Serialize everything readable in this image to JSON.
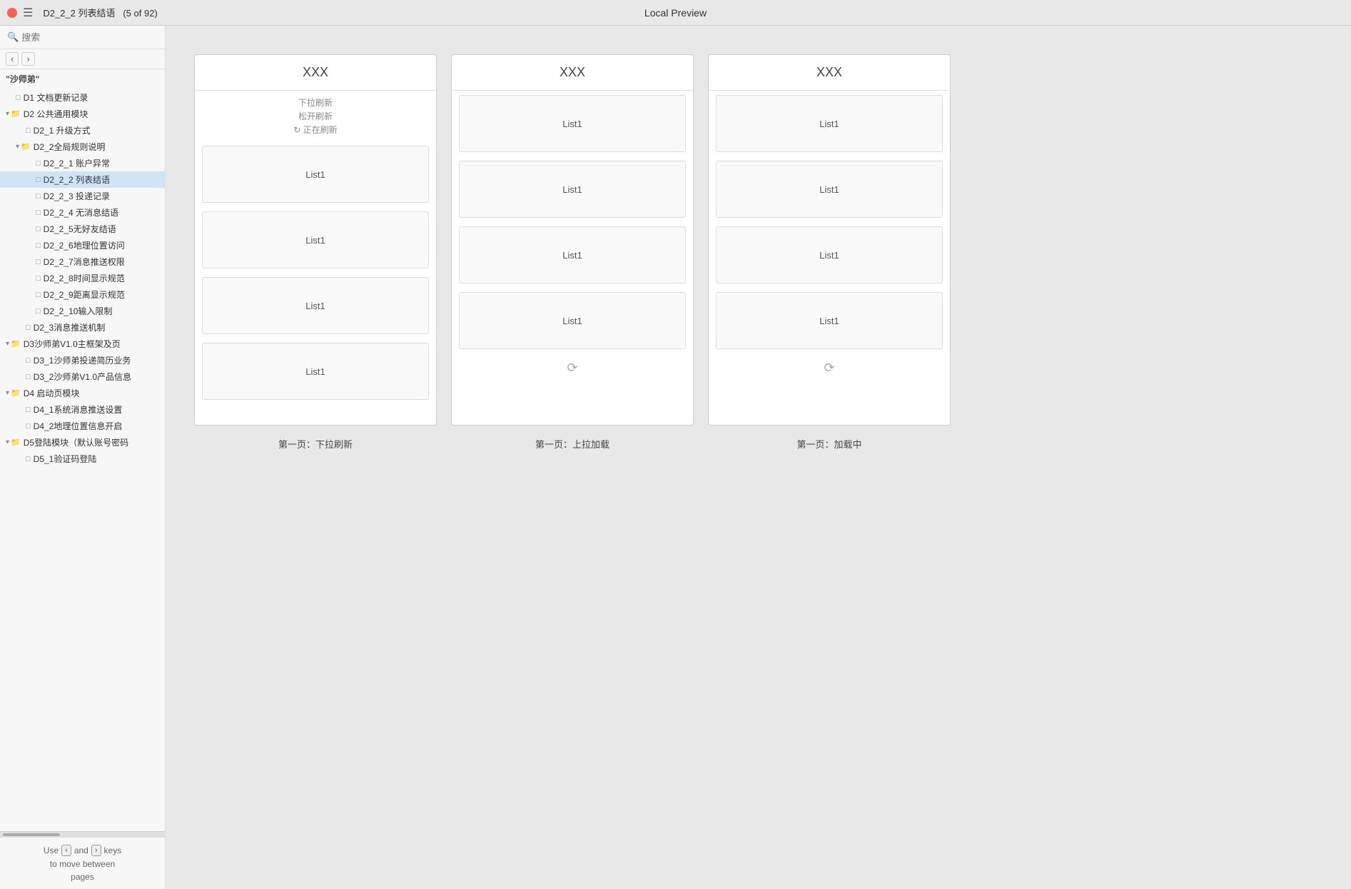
{
  "topbar": {
    "title": "D2_2_2 列表结语",
    "subtitle": "(5 of 92)",
    "preview_title": "Local Preview",
    "close_btn": "×"
  },
  "sidebar": {
    "search_placeholder": "搜索",
    "nav_back": "‹",
    "nav_forward": "›",
    "root_label": "\"沙师弟\"",
    "tree_items": [
      {
        "id": "d1",
        "label": "D1 文档更新记录",
        "level": 0,
        "type": "doc",
        "expanded": false
      },
      {
        "id": "d2",
        "label": "D2 公共通用模块",
        "level": 0,
        "type": "folder-open",
        "expanded": true
      },
      {
        "id": "d2_1",
        "label": "D2_1 升级方式",
        "level": 1,
        "type": "doc",
        "expanded": false
      },
      {
        "id": "d2_2",
        "label": "D2_2全局规则说明",
        "level": 1,
        "type": "folder-open",
        "expanded": true
      },
      {
        "id": "d2_2_1",
        "label": "D2_2_1 账户异常",
        "level": 2,
        "type": "doc",
        "expanded": false
      },
      {
        "id": "d2_2_2",
        "label": "D2_2_2 列表结语",
        "level": 2,
        "type": "doc",
        "expanded": false,
        "active": true
      },
      {
        "id": "d2_2_3",
        "label": "D2_2_3 投递记录",
        "level": 2,
        "type": "doc",
        "expanded": false
      },
      {
        "id": "d2_2_4",
        "label": "D2_2_4 无消息结语",
        "level": 2,
        "type": "doc",
        "expanded": false
      },
      {
        "id": "d2_2_5",
        "label": "D2_2_5无好友结语",
        "level": 2,
        "type": "doc",
        "expanded": false
      },
      {
        "id": "d2_2_6",
        "label": "D2_2_6地理位置访问",
        "level": 2,
        "type": "doc",
        "expanded": false
      },
      {
        "id": "d2_2_7",
        "label": "D2_2_7消息推送权限",
        "level": 2,
        "type": "doc",
        "expanded": false
      },
      {
        "id": "d2_2_8",
        "label": "D2_2_8时间显示规范",
        "level": 2,
        "type": "doc",
        "expanded": false
      },
      {
        "id": "d2_2_9",
        "label": "D2_2_9距离显示规范",
        "level": 2,
        "type": "doc",
        "expanded": false
      },
      {
        "id": "d2_2_10",
        "label": "D2_2_10输入限制",
        "level": 2,
        "type": "doc",
        "expanded": false
      },
      {
        "id": "d2_3",
        "label": "D2_3消息推送机制",
        "level": 1,
        "type": "doc",
        "expanded": false
      },
      {
        "id": "d3",
        "label": "D3沙师弟V1.0主框架及页",
        "level": 0,
        "type": "folder",
        "expanded": true
      },
      {
        "id": "d3_1",
        "label": "D3_1沙师弟投递简历业务",
        "level": 1,
        "type": "doc",
        "expanded": false
      },
      {
        "id": "d3_2",
        "label": "D3_2沙师弟V1.0产品信息",
        "level": 1,
        "type": "doc",
        "expanded": false
      },
      {
        "id": "d4",
        "label": "D4 启动页模块",
        "level": 0,
        "type": "folder",
        "expanded": true
      },
      {
        "id": "d4_1",
        "label": "D4_1系统消息推送设置",
        "level": 1,
        "type": "doc",
        "expanded": false
      },
      {
        "id": "d4_2",
        "label": "D4_2地理位置信息开启",
        "level": 1,
        "type": "doc",
        "expanded": false
      },
      {
        "id": "d5",
        "label": "D5登陆模块（默认账号密码",
        "level": 0,
        "type": "folder",
        "expanded": true
      },
      {
        "id": "d5_1",
        "label": "D5_1验证码登陆",
        "level": 1,
        "type": "doc",
        "expanded": false
      }
    ],
    "bottom_text1": "Use",
    "bottom_text2": "and",
    "bottom_text3": "keys",
    "bottom_text4": "to move between",
    "bottom_text5": "pages",
    "key_prev": "‹",
    "key_next": "›"
  },
  "panels": [
    {
      "id": "panel1",
      "header": "XXX",
      "type": "pull-refresh",
      "pull_states": [
        "下拉刷新",
        "松开刷新",
        "↻ 正在刷新"
      ],
      "list_items": [
        "List1",
        "List1",
        "List1",
        "List1"
      ],
      "label": "第一页：下拉刷新"
    },
    {
      "id": "panel2",
      "header": "XXX",
      "type": "pull-up-load",
      "list_items": [
        "List1",
        "List1",
        "List1",
        "List1"
      ],
      "show_spinner": true,
      "label": "第一页：上拉加载"
    },
    {
      "id": "panel3",
      "header": "XXX",
      "type": "loading",
      "list_items": [
        "List1",
        "List1",
        "List1",
        "List1"
      ],
      "show_spinner": true,
      "label": "第一页：加载中"
    }
  ]
}
